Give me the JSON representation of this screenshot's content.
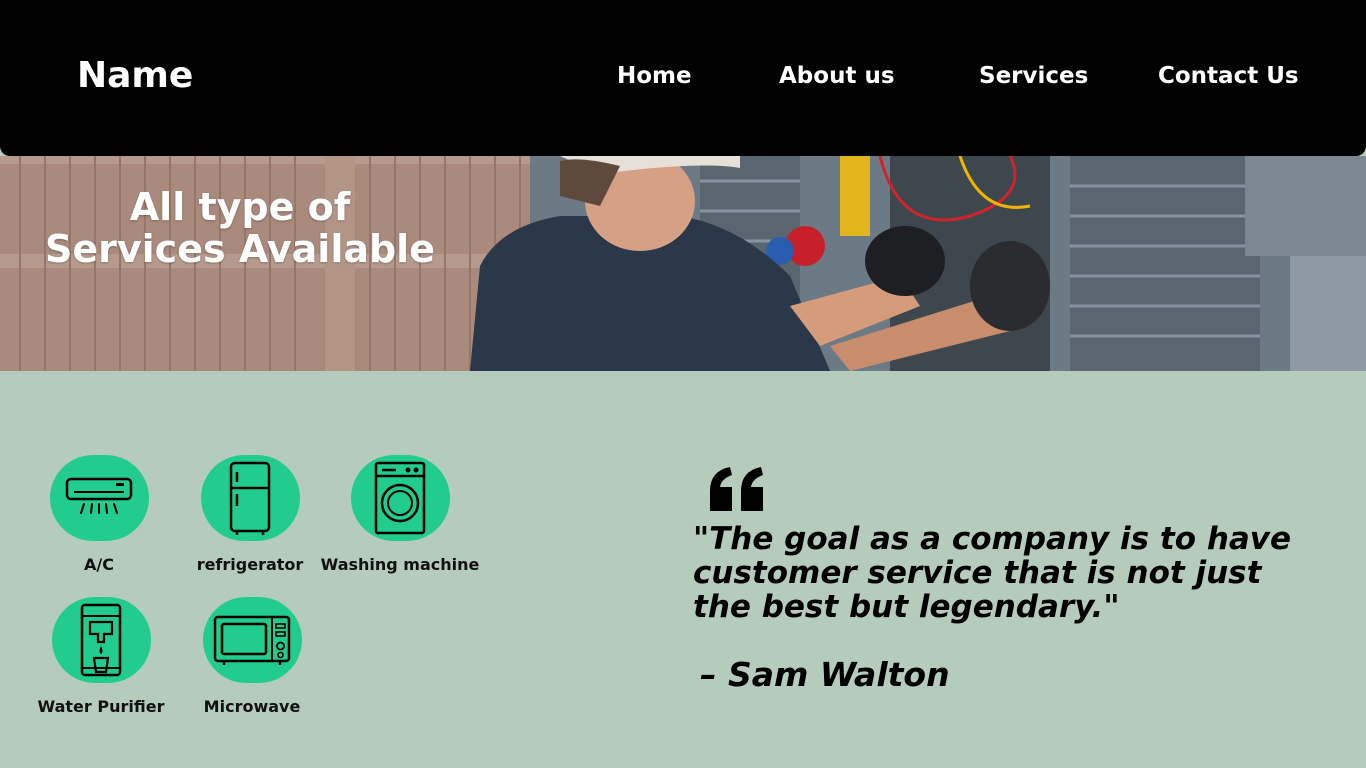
{
  "header": {
    "brand": "Name",
    "nav": {
      "home": "Home",
      "about": "About us",
      "services": "Services",
      "contact": "Contact Us"
    }
  },
  "hero": {
    "title": "All type of Services Available"
  },
  "services": [
    {
      "label": "A/C",
      "icon": "air-conditioner-icon"
    },
    {
      "label": "refrigerator",
      "icon": "refrigerator-icon"
    },
    {
      "label": "Washing machine",
      "icon": "washing-machine-icon"
    },
    {
      "label": "Water Purifier",
      "icon": "water-purifier-icon"
    },
    {
      "label": "Microwave",
      "icon": "microwave-icon"
    }
  ],
  "quote": {
    "text": "\"The goal as a company is to have customer service that is not just the best but legendary.\"",
    "author": "– Sam Walton"
  },
  "colors": {
    "header_bg": "#000000",
    "page_bg": "#b5cbbb",
    "icon_circle": "#21cc8e"
  }
}
